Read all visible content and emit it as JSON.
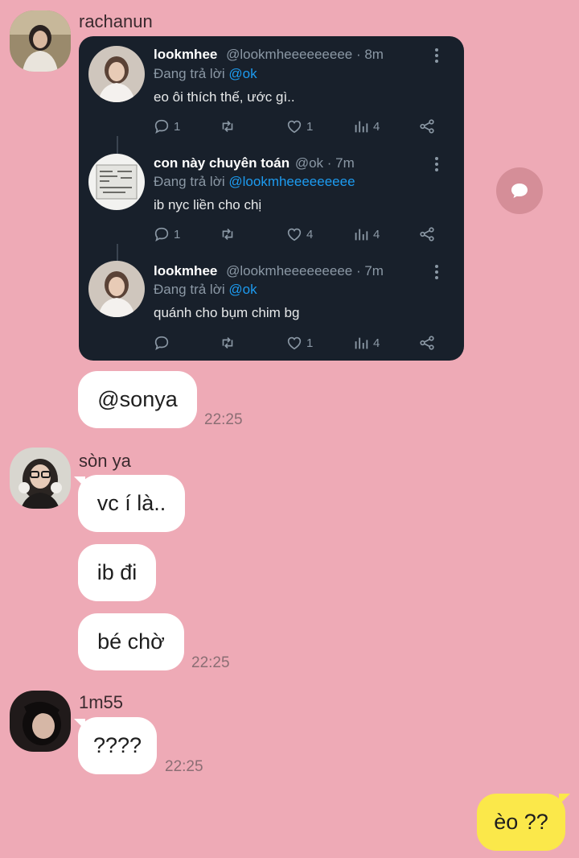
{
  "colors": {
    "background": "#eeaab6",
    "bubble": "#ffffff",
    "my_bubble": "#fbe84a",
    "card": "#18202b",
    "mention": "#1d9bf0"
  },
  "messages": [
    {
      "sender": "rachanun",
      "mention_text": "@sonya",
      "time": "22:25"
    },
    {
      "sender": "sòn ya",
      "bubbles": [
        "vc í là..",
        "ib đi",
        "bé chờ"
      ],
      "time": "22:25"
    },
    {
      "sender": "1m55",
      "bubbles": [
        "????"
      ],
      "time": "22:25"
    }
  ],
  "my_message": "èo ??",
  "tweets": [
    {
      "name": "lookmhee",
      "handle": "@lookmheeeeeeeee · 8m",
      "reply_prefix": "Đang trả lời",
      "reply_to": "@ok",
      "text": "eo ôi thích thế, ước gì..",
      "replies": "1",
      "likes": "1",
      "views": "4",
      "retweets": ""
    },
    {
      "name": "con này chuyên toán",
      "handle": "@ok · 7m",
      "reply_prefix": "Đang trả lời",
      "reply_to": "@lookmheeeeeeeee",
      "text": "ib nyc liền cho chị",
      "replies": "1",
      "likes": "4",
      "views": "4",
      "retweets": ""
    },
    {
      "name": "lookmhee",
      "handle": "@lookmheeeeeeeee · 7m",
      "reply_prefix": "Đang trả lời",
      "reply_to": "@ok",
      "text": "quánh cho bụm chim bg",
      "replies": "",
      "likes": "1",
      "views": "4",
      "retweets": ""
    }
  ],
  "icons": [
    "reply-icon",
    "retweet-icon",
    "like-icon",
    "views-icon",
    "share-icon",
    "more-icon",
    "chat-bubble-icon"
  ]
}
